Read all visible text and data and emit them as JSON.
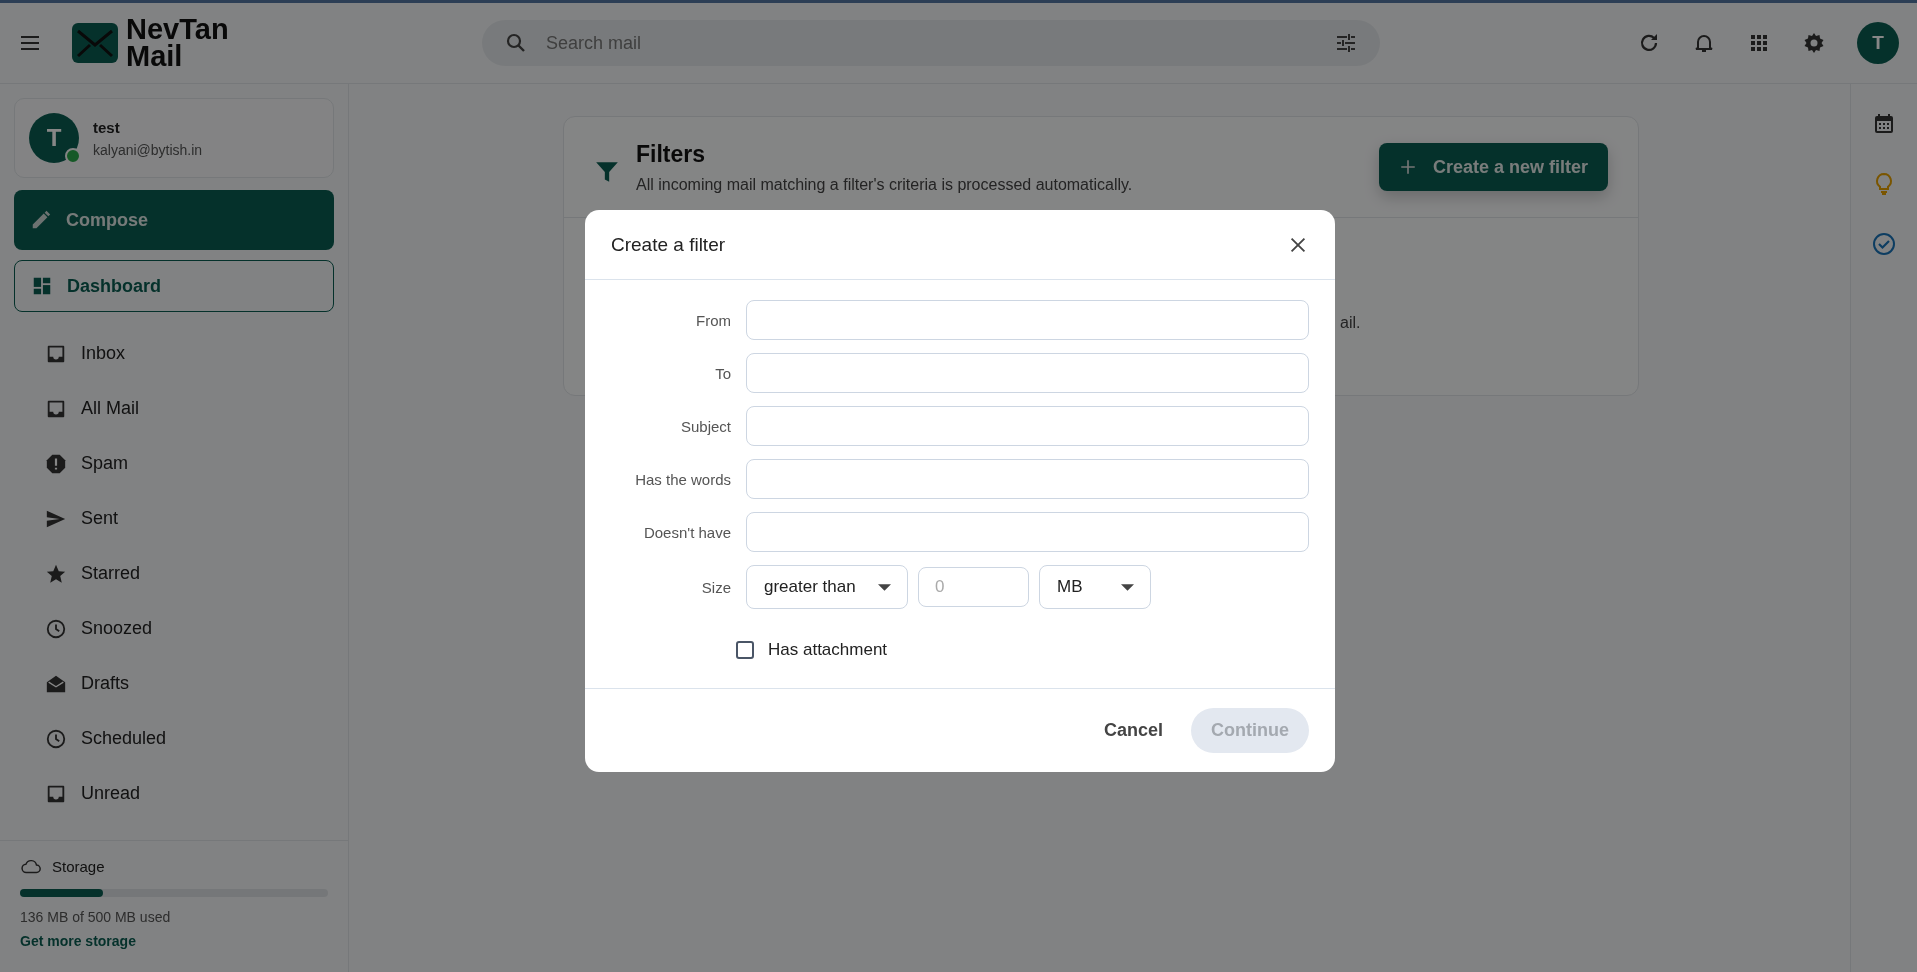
{
  "app": {
    "logo_line1": "NevTan",
    "logo_line2": "Mail"
  },
  "search": {
    "placeholder": "Search mail"
  },
  "account_avatar": "T",
  "profile": {
    "initial": "T",
    "name": "test",
    "email": "kalyani@bytish.in",
    "online": true
  },
  "compose": "Compose",
  "dashboard": "Dashboard",
  "nav": [
    {
      "label": "Inbox",
      "kind": "tray"
    },
    {
      "label": "All Mail",
      "kind": "tray"
    },
    {
      "label": "Spam",
      "kind": "alert"
    },
    {
      "label": "Sent",
      "kind": "send"
    },
    {
      "label": "Starred",
      "kind": "star"
    },
    {
      "label": "Snoozed",
      "kind": "clock"
    },
    {
      "label": "Drafts",
      "kind": "drafts"
    },
    {
      "label": "Scheduled",
      "kind": "clock"
    },
    {
      "label": "Unread",
      "kind": "tray"
    }
  ],
  "storage": {
    "label": "Storage",
    "level": 0.27,
    "usage": "136 MB of 500 MB used",
    "link": "Get more storage"
  },
  "filters_page": {
    "title": "Filters",
    "subtitle": "All incoming mail matching a filter's criteria is processed automatically.",
    "create_button": "Create a new filter",
    "body_fragment": "ail."
  },
  "dialog": {
    "title": "Create a filter",
    "fields": [
      {
        "label": "From"
      },
      {
        "label": "To"
      },
      {
        "label": "Subject"
      },
      {
        "label": "Has the words"
      },
      {
        "label": "Doesn't have"
      }
    ],
    "size": {
      "label": "Size",
      "comparison": "greater than",
      "value_placeholder": "0",
      "unit": "MB"
    },
    "has_attachment": {
      "label": "Has attachment",
      "checked": false
    },
    "cancel": "Cancel",
    "continue": {
      "label": "Continue",
      "disabled": true
    }
  }
}
